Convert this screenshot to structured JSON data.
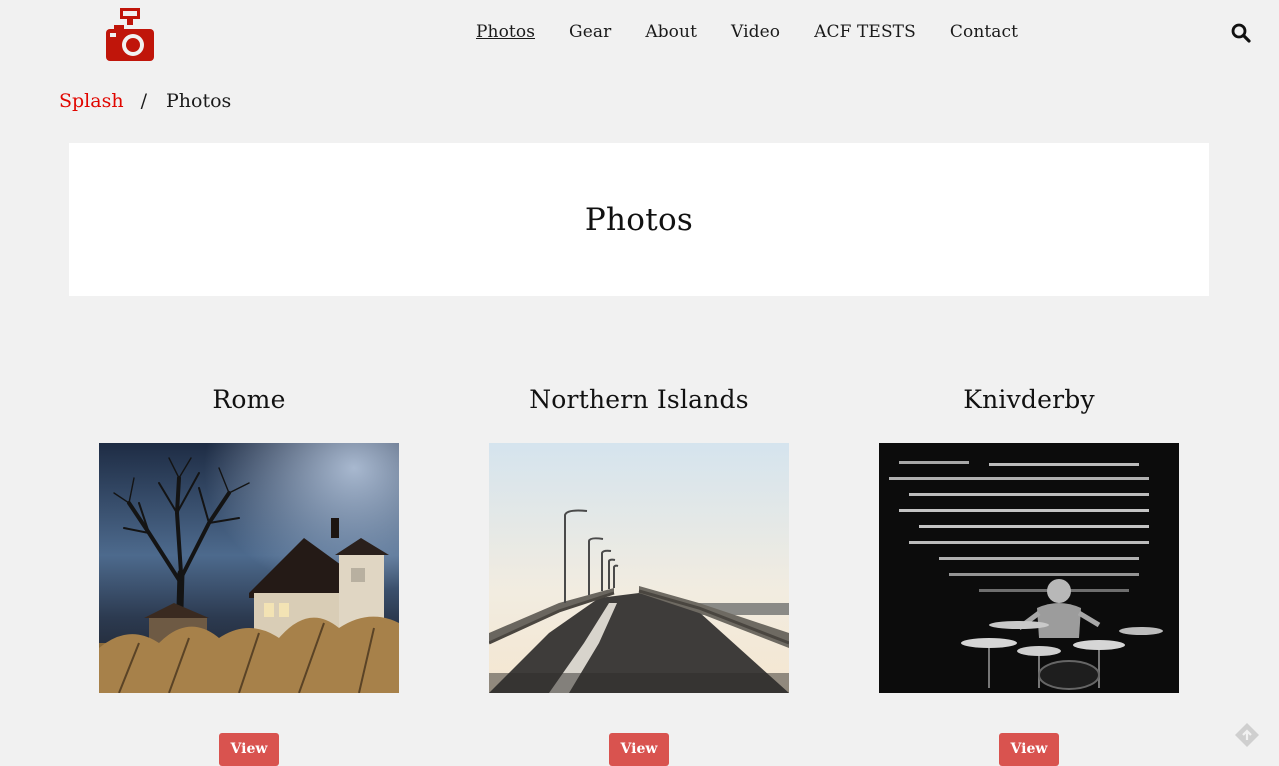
{
  "header": {
    "logo_icon": "camera-flash-icon",
    "brand_color": "#c0150a",
    "nav": [
      {
        "label": "Photos",
        "active": true
      },
      {
        "label": "Gear",
        "active": false
      },
      {
        "label": "About",
        "active": false
      },
      {
        "label": "Video",
        "active": false
      },
      {
        "label": "ACF TESTS",
        "active": false
      },
      {
        "label": "Contact",
        "active": false
      }
    ],
    "search_icon": "search-icon"
  },
  "breadcrumb": {
    "link_label": "Splash",
    "separator": "/",
    "current": "Photos",
    "link_color": "#e10600"
  },
  "page": {
    "title": "Photos"
  },
  "gallery": [
    {
      "title": "Rome",
      "image_subject": "tree and house at night",
      "button_label": "View"
    },
    {
      "title": "Northern Islands",
      "image_subject": "bridge road with street lamps",
      "button_label": "View"
    },
    {
      "title": "Knivderby",
      "image_subject": "drummer on stage black and white",
      "button_label": "View"
    }
  ],
  "colors": {
    "background": "#f1f1f1",
    "button": "#d9534f",
    "panel": "#ffffff"
  },
  "widgets": {
    "corner_icon": "feedback-icon"
  }
}
